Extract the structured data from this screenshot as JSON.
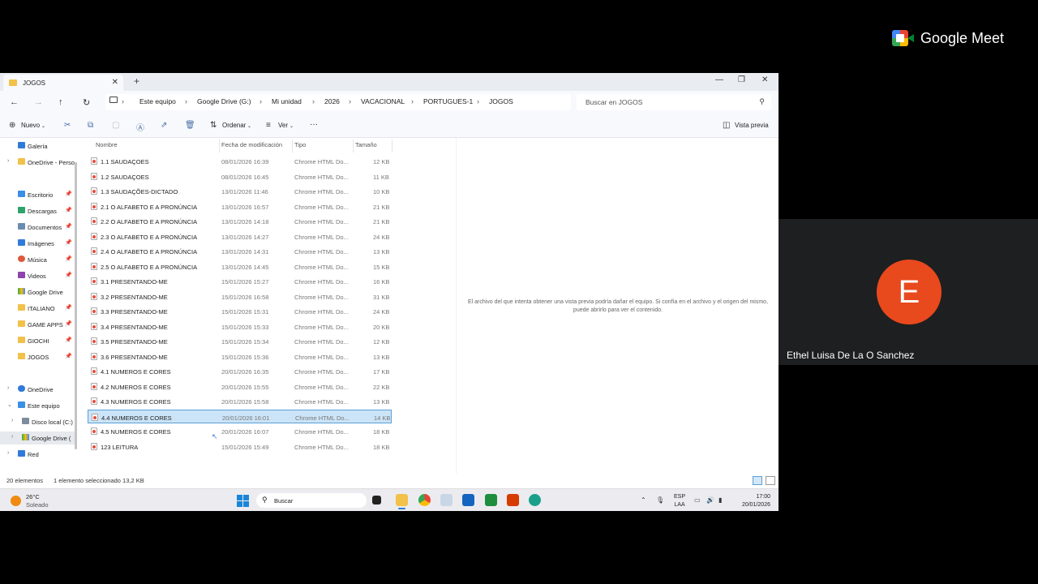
{
  "explorer": {
    "tab_title": "JOGOS",
    "breadcrumbs": [
      "Este equipo",
      "Google Drive (G:)",
      "Mi unidad",
      "2026",
      "VACACIONAL",
      "PORTUGUES-1",
      "JOGOS"
    ],
    "search_placeholder": "Buscar en JOGOS",
    "toolbar": {
      "new": "Nuevo",
      "sort": "Ordenar",
      "view": "Ver",
      "more": "···",
      "preview": "Vista previa"
    },
    "sidebar": {
      "galeria": "Galería",
      "onedrive_personal": "OneDrive - Perso",
      "escritorio": "Escritorio",
      "descargas": "Descargas",
      "documentos": "Documentos",
      "imagenes": "Imágenes",
      "musica": "Música",
      "videos": "Videos",
      "google_drive": "Google Drive",
      "italiano": "ITALIANO",
      "game_apps": "GAME APPS",
      "giochi": "GIOCHI",
      "jogos": "JOGOS",
      "onedrive": "OneDrive",
      "este_equipo": "Este equipo",
      "disco_local": "Disco local (C:)",
      "google_drive_g": "Google Drive (",
      "red": "Red"
    },
    "columns": {
      "name": "Nombre",
      "date": "Fecha de modificación",
      "type": "Tipo",
      "size": "Tamaño"
    },
    "files": [
      {
        "name": "1.1 SAUDAÇOES",
        "date": "08/01/2026 16:39",
        "type": "Chrome HTML Do...",
        "size": "12 KB"
      },
      {
        "name": "1.2 SAUDAÇOES",
        "date": "08/01/2026 16:45",
        "type": "Chrome HTML Do...",
        "size": "11 KB"
      },
      {
        "name": "1.3 SAUDAÇÕES-DICTADO",
        "date": "13/01/2026 11:46",
        "type": "Chrome HTML Do...",
        "size": "10 KB"
      },
      {
        "name": "2.1 O ALFABETO E A PRONÚNCIA",
        "date": "13/01/2026 16:57",
        "type": "Chrome HTML Do...",
        "size": "21 KB"
      },
      {
        "name": "2.2 O ALFABETO E A PRONÚNCIA",
        "date": "13/01/2026 14:18",
        "type": "Chrome HTML Do...",
        "size": "21 KB"
      },
      {
        "name": "2.3 O ALFABETO E A PRONÚNCIA",
        "date": "13/01/2026 14:27",
        "type": "Chrome HTML Do...",
        "size": "24 KB"
      },
      {
        "name": "2.4 O ALFABETO E A PRONÚNCIA",
        "date": "13/01/2026 14:31",
        "type": "Chrome HTML Do...",
        "size": "13 KB"
      },
      {
        "name": "2.5 O ALFABETO E A PRONÚNCIA",
        "date": "13/01/2026 14:45",
        "type": "Chrome HTML Do...",
        "size": "15 KB"
      },
      {
        "name": "3.1 PRESENTANDO-ME",
        "date": "15/01/2026 15:27",
        "type": "Chrome HTML Do...",
        "size": "16 KB"
      },
      {
        "name": "3.2 PRESENTANDO-ME",
        "date": "15/01/2026 16:58",
        "type": "Chrome HTML Do...",
        "size": "31 KB"
      },
      {
        "name": "3.3 PRESENTANDO-ME",
        "date": "15/01/2026 15:31",
        "type": "Chrome HTML Do...",
        "size": "24 KB"
      },
      {
        "name": "3.4 PRESENTANDO-ME",
        "date": "15/01/2026 15:33",
        "type": "Chrome HTML Do...",
        "size": "20 KB"
      },
      {
        "name": "3.5 PRESENTANDO-ME",
        "date": "15/01/2026 15:34",
        "type": "Chrome HTML Do...",
        "size": "12 KB"
      },
      {
        "name": "3.6 PRESENTANDO-ME",
        "date": "15/01/2026 15:36",
        "type": "Chrome HTML Do...",
        "size": "13 KB"
      },
      {
        "name": "4.1 NUMEROS E CORES",
        "date": "20/01/2026 16:35",
        "type": "Chrome HTML Do...",
        "size": "17 KB"
      },
      {
        "name": "4.2 NUMEROS E CORES",
        "date": "20/01/2026 15:55",
        "type": "Chrome HTML Do...",
        "size": "22 KB"
      },
      {
        "name": "4.3 NUMEROS E CORES",
        "date": "20/01/2026 15:58",
        "type": "Chrome HTML Do...",
        "size": "13 KB"
      },
      {
        "name": "4.4 NUMEROS E CORES",
        "date": "20/01/2026 16:01",
        "type": "Chrome HTML Do...",
        "size": "14 KB",
        "selected": true
      },
      {
        "name": "4.5 NUMEROS E CORES",
        "date": "20/01/2026 16:07",
        "type": "Chrome HTML Do...",
        "size": "18 KB"
      },
      {
        "name": "123 LEITURA",
        "date": "15/01/2026 15:49",
        "type": "Chrome HTML Do...",
        "size": "18 KB"
      }
    ],
    "preview_message_1": "El archivo del que intenta obtener una vista previa podría dañar el equipo. Si confía en el archivo y el origen del mismo,",
    "preview_message_2": "puede abrirlo para ver el contenido.",
    "status": {
      "count": "20 elementos",
      "selection": "1 elemento seleccionado  13,2 KB"
    }
  },
  "taskbar": {
    "temperature": "26°C",
    "weather": "Soleado",
    "search": "Buscar",
    "lang_1": "ESP",
    "lang_2": "LAA",
    "time": "17:00",
    "date": "20/01/2026"
  },
  "meet": {
    "brand": "Google Meet",
    "avatar_letter": "E",
    "participant_name": "Ethel Luisa De La O Sanchez"
  },
  "colors": {
    "selection": "#cce4f7",
    "avatar": "#e8491d",
    "accent": "#1a86d9"
  }
}
